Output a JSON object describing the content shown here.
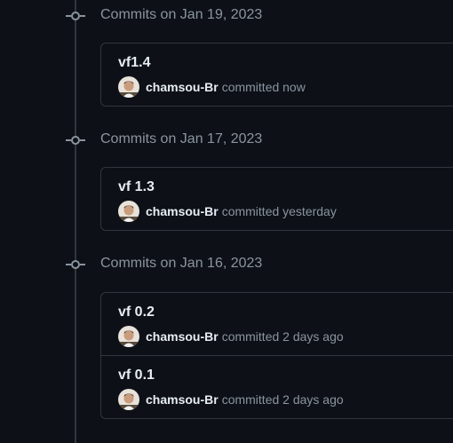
{
  "timeline": {
    "groups": [
      {
        "title": "Commits on Jan 19, 2023",
        "commits": [
          {
            "title": "vf1.4",
            "author": "chamsou-Br",
            "meta": "committed now"
          }
        ]
      },
      {
        "title": "Commits on Jan 17, 2023",
        "commits": [
          {
            "title": "vf 1.3",
            "author": "chamsou-Br",
            "meta": "committed yesterday"
          }
        ]
      },
      {
        "title": "Commits on Jan 16, 2023",
        "commits": [
          {
            "title": "vf 0.2",
            "author": "chamsou-Br",
            "meta": "committed 2 days ago"
          },
          {
            "title": "vf 0.1",
            "author": "chamsou-Br",
            "meta": "committed 2 days ago"
          }
        ]
      }
    ]
  },
  "icons": {
    "timeline_node": "git-commit-icon",
    "avatar": "user-avatar"
  },
  "colors": {
    "background": "#0d1117",
    "border": "#30363d",
    "text_primary": "#e6edf3",
    "text_muted": "#8b949e"
  }
}
